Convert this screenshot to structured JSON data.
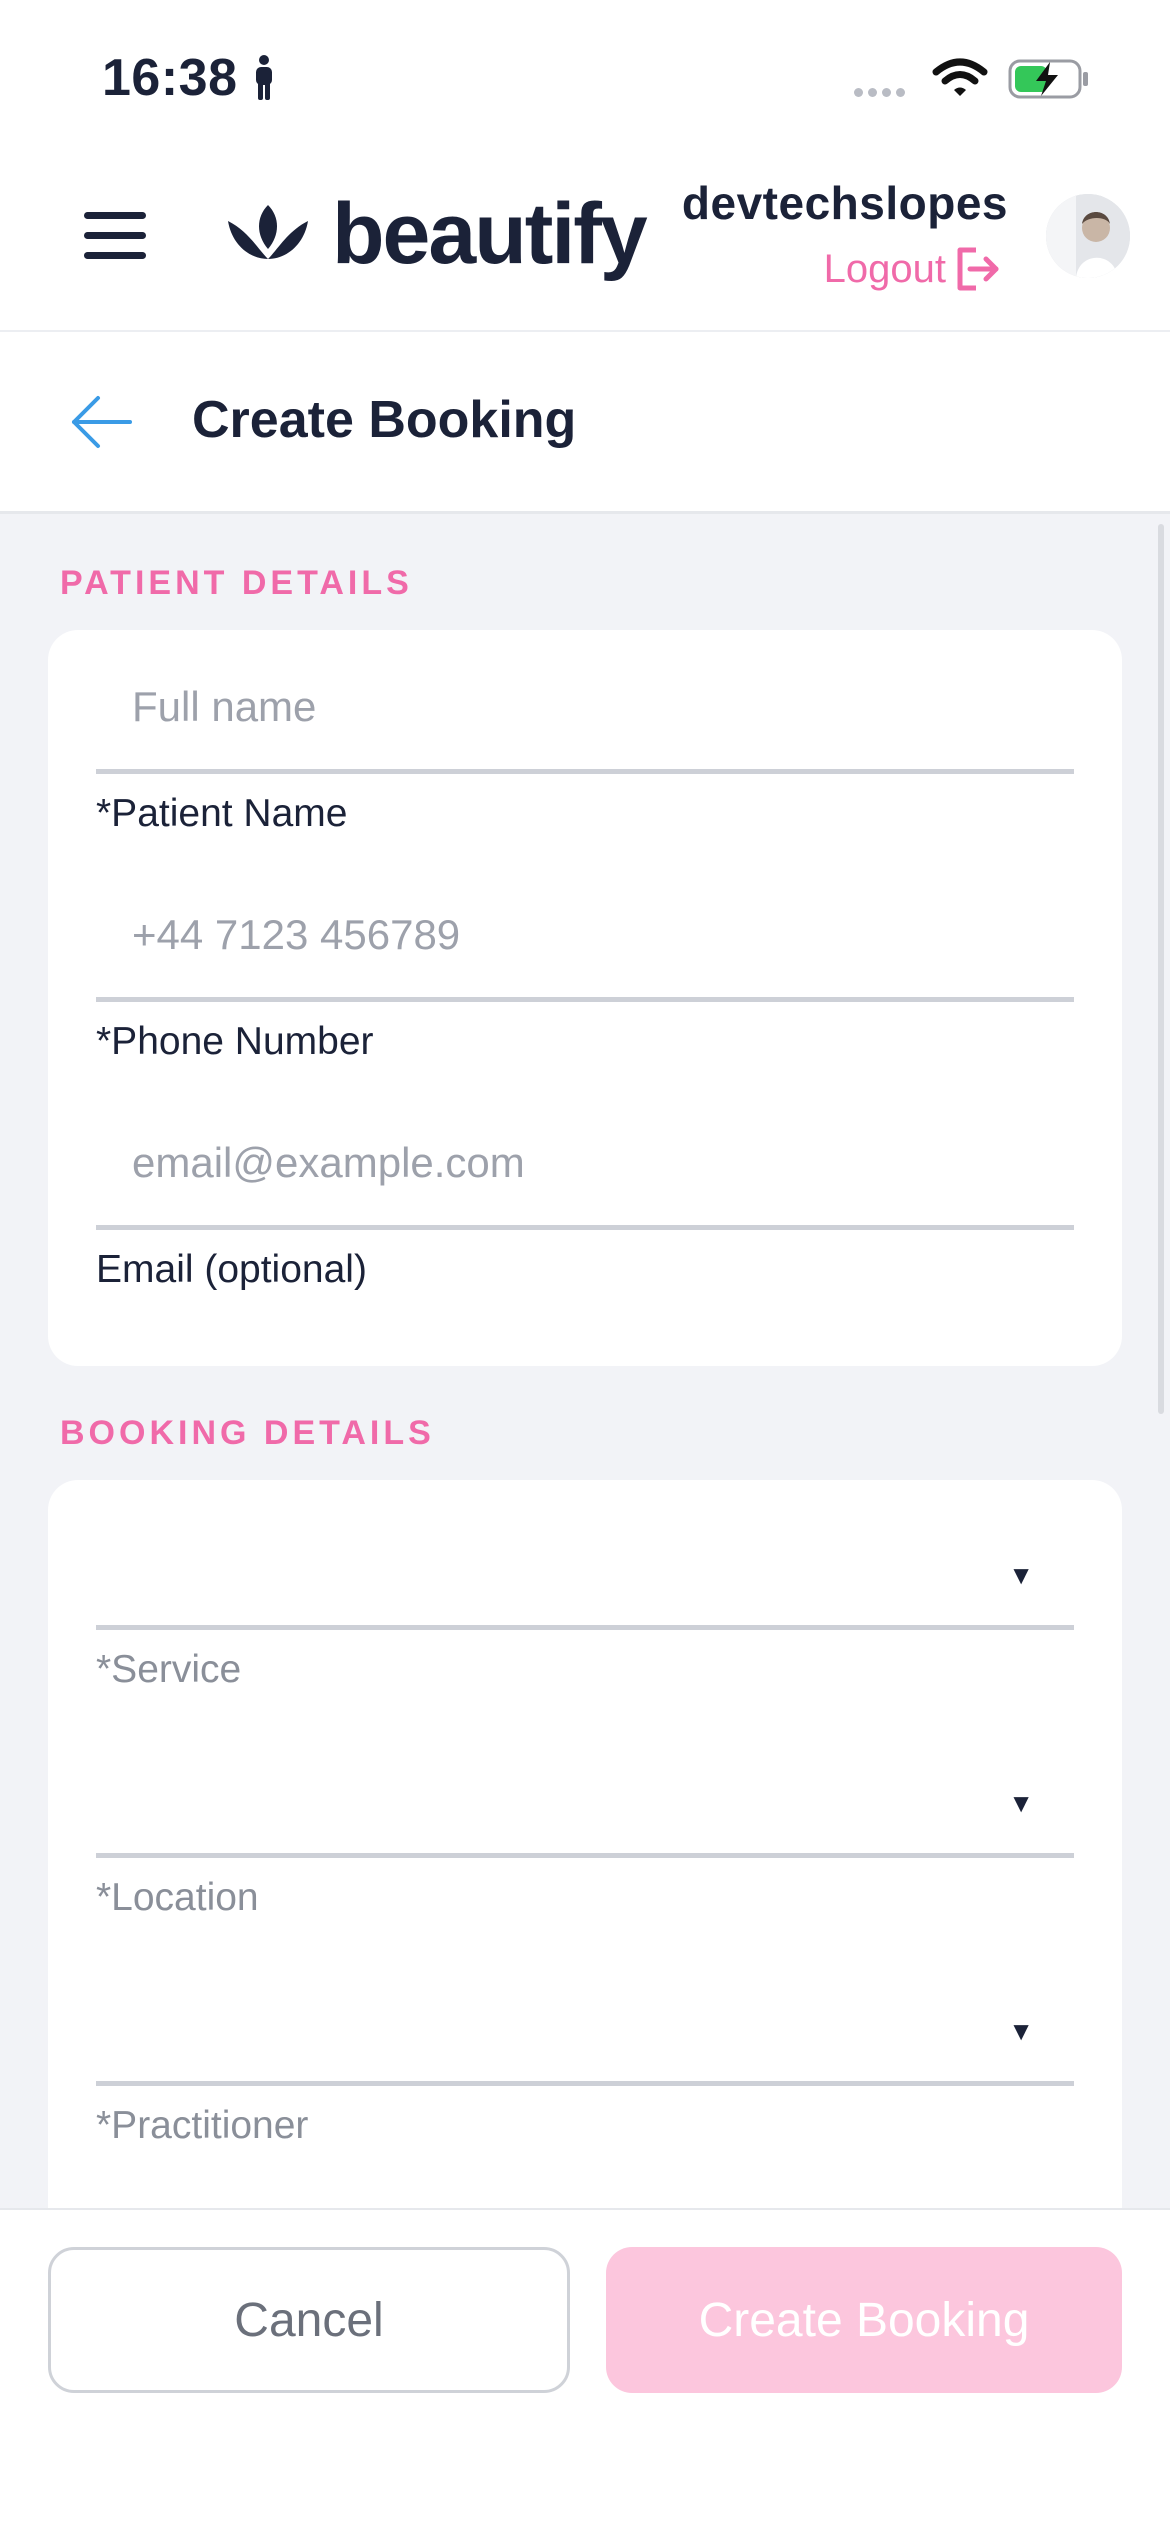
{
  "status_bar": {
    "time": "16:38",
    "icons": [
      "person-icon",
      "signal-dots-icon",
      "wifi-icon",
      "battery-charging-icon"
    ]
  },
  "header": {
    "logo_text": "beautify",
    "user_name": "devtechslopes",
    "logout_label": "Logout"
  },
  "page": {
    "title": "Create Booking"
  },
  "patient_details": {
    "section_label": "PATIENT DETAILS",
    "fields": [
      {
        "placeholder": "Full name",
        "label": "*Patient Name"
      },
      {
        "placeholder": "+44 7123 456789",
        "label": "*Phone Number"
      },
      {
        "placeholder": "email@example.com",
        "label": "Email (optional)"
      }
    ]
  },
  "booking_details": {
    "section_label": "BOOKING DETAILS",
    "selects": [
      {
        "value": "",
        "label": "*Service"
      },
      {
        "value": "",
        "label": "*Location"
      },
      {
        "value": "",
        "label": "*Practitioner"
      }
    ]
  },
  "footer": {
    "cancel_label": "Cancel",
    "create_label": "Create Booking"
  },
  "colors": {
    "brand_pink": "#f06aa9",
    "disabled_pink": "#fcc6dd",
    "navy": "#1b2238",
    "back_arrow_blue": "#3a9be6",
    "background": "#f2f3f7"
  }
}
